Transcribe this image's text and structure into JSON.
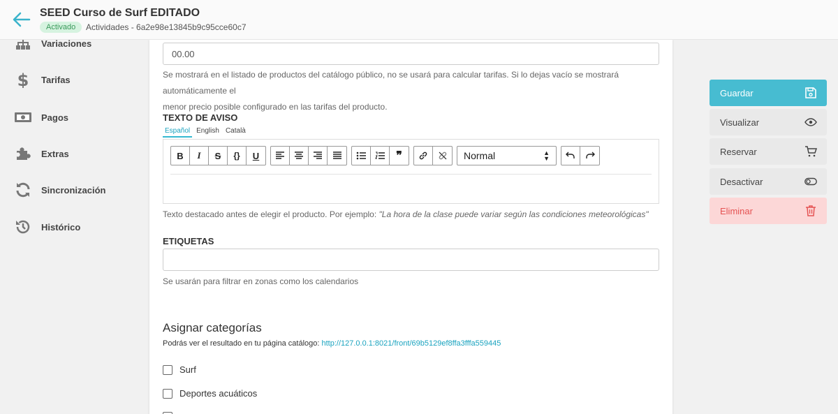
{
  "header": {
    "title": "SEED Curso de Surf EDITADO",
    "status": "Activado",
    "breadcrumb": "Actividades - 6a2e98e13845b9c95cce60c7"
  },
  "sidebar": {
    "items": [
      {
        "label": "Variaciones",
        "icon": "sitemap-icon"
      },
      {
        "label": "Tarifas",
        "icon": "dollar-icon"
      },
      {
        "label": "Pagos",
        "icon": "money-icon"
      },
      {
        "label": "Extras",
        "icon": "puzzle-icon"
      },
      {
        "label": "Sincronización",
        "icon": "sync-icon"
      },
      {
        "label": "Histórico",
        "icon": "history-icon"
      }
    ]
  },
  "form": {
    "price_value": "00.00",
    "price_help_line1": "Se mostrará en el listado de productos del catálogo público, no se usará para calcular tarifas. Si lo dejas vacío se mostrará automáticamente el",
    "price_help_line2": "menor precio posible configurado en las tarifas del producto.",
    "notice_label": "TEXTO DE AVISO",
    "languages": [
      "Español",
      "English",
      "Català"
    ],
    "active_language": "Español",
    "format_select": "Normal",
    "notice_help": "Texto destacado antes de elegir el producto. Por ejemplo: ",
    "notice_example": "\"La hora de la clase puede variar según las condiciones meteorológicas\"",
    "tags_label": "ETIQUETAS",
    "tags_value": "",
    "tags_help": "Se usarán para filtrar en zonas como los calendarios",
    "categories_title": "Asignar categorías",
    "categories_sub": "Podrás ver el resultado en tu página catálogo: ",
    "categories_link": "http://127.0.0.1:8021/front/69b5129ef8ffa3fffa559445",
    "categories": [
      {
        "label": "Surf",
        "checked": false
      },
      {
        "label": "Deportes acuáticos",
        "checked": false
      }
    ]
  },
  "actions": {
    "save": "Guardar",
    "view": "Visualizar",
    "book": "Reservar",
    "deactivate": "Desactivar",
    "delete": "Eliminar"
  },
  "colors": {
    "accent": "#47bcd1",
    "link": "#1aa3bf",
    "danger_bg": "#fcd7d7",
    "danger_text": "#e55353",
    "badge_bg": "#d6f3e0",
    "badge_text": "#3a9a5b"
  }
}
